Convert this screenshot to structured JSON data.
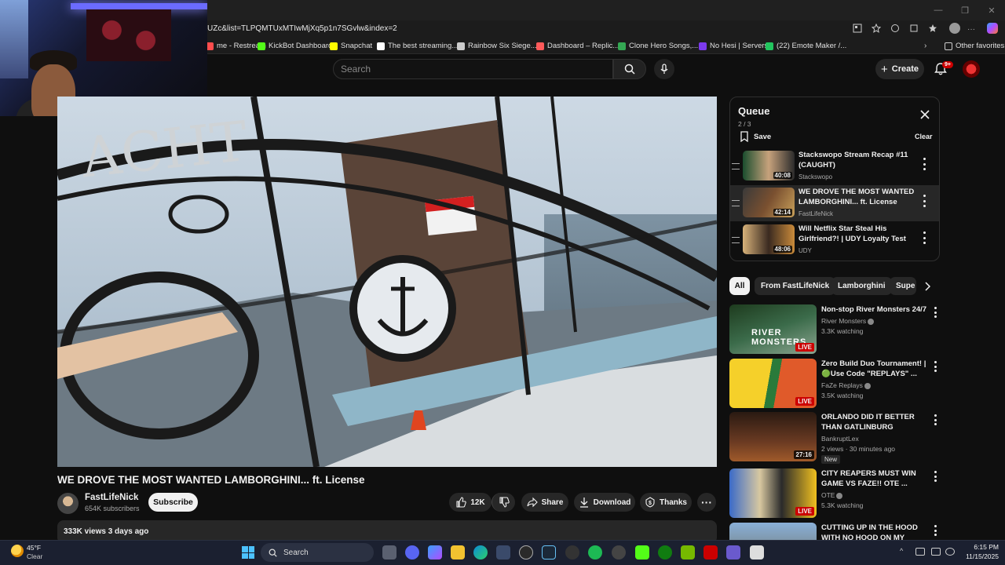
{
  "browser": {
    "url": "UZc&list=TLPQMTUxMTIwMjXq5p1n7SGvlw&index=2",
    "bookmarks": [
      {
        "label": "me - Restream",
        "color": "#ff4d4d"
      },
      {
        "label": "KickBot Dashboard",
        "color": "#53fc18"
      },
      {
        "label": "Snapchat",
        "color": "#fffc00"
      },
      {
        "label": "The best streaming...",
        "color": "#ffffff"
      },
      {
        "label": "Rainbow Six Siege...",
        "color": "#cccccc"
      },
      {
        "label": "Dashboard – Replic...",
        "color": "#ff5a5a"
      },
      {
        "label": "Clone Hero Songs,...",
        "color": "#34a853"
      },
      {
        "label": "No Hesi | Servers",
        "color": "#7c3aed"
      },
      {
        "label": "(22) Emote Maker /...",
        "color": "#22c55e"
      }
    ],
    "other_favorites": "Other favorites"
  },
  "header": {
    "search_placeholder": "Search",
    "create_label": "Create",
    "notification_count": "9+"
  },
  "video": {
    "title": "WE DROVE THE MOST WANTED LAMBORGHINI... ft. License",
    "channel": "FastLifeNick",
    "subscribers": "654K subscribers",
    "subscribe_label": "Subscribe",
    "likes": "12K",
    "share_label": "Share",
    "download_label": "Download",
    "thanks_label": "Thanks",
    "views_date": "333K views  3 days ago"
  },
  "queue": {
    "title": "Queue",
    "position": "2 / 3",
    "save_label": "Save",
    "clear_label": "Clear",
    "items": [
      {
        "title": "Stackswopo Stream Recap #11 (CAUGHT)",
        "channel": "Stackswopo",
        "duration": "40:08"
      },
      {
        "title": "WE DROVE THE MOST WANTED LAMBORGHINI... ft. License",
        "channel": "FastLifeNick",
        "duration": "42:14"
      },
      {
        "title": "Will Netflix Star Steal His Girlfriend?! | UDY Loyalty Test",
        "channel": "UDY",
        "duration": "48:06"
      }
    ]
  },
  "chips": [
    "All",
    "From FastLifeNick",
    "Lamborghini",
    "Supe"
  ],
  "recommendations": [
    {
      "title": "Non-stop River Monsters 24/7",
      "channel": "River Monsters",
      "meta": "3.3K watching",
      "badge": "LIVE"
    },
    {
      "title": "Zero Build Duo Tournament! | 🟢Use Code \"REPLAYS\" ...",
      "channel": "FaZe Replays",
      "meta": "3.5K watching",
      "badge": "LIVE"
    },
    {
      "title": "ORLANDO DID IT BETTER THAN GATLINBURG",
      "channel": "BankruptLex",
      "meta": "2 views · 30 minutes ago",
      "badge": "27:16",
      "tag": "New"
    },
    {
      "title": "CITY REAPERS MUST WIN GAME VS FAZE!! OTE ...",
      "channel": "OTE",
      "meta": "5.3K watching",
      "badge": "LIVE"
    },
    {
      "title": "CUTTING UP IN THE HOOD WITH NO HOOD ON MY REPE...",
      "channel": "",
      "meta": "",
      "badge": ""
    }
  ],
  "taskbar": {
    "temp": "45°F",
    "condition": "Clear",
    "search_label": "Search",
    "time": "6:15 PM",
    "date": "11/15/2025"
  }
}
